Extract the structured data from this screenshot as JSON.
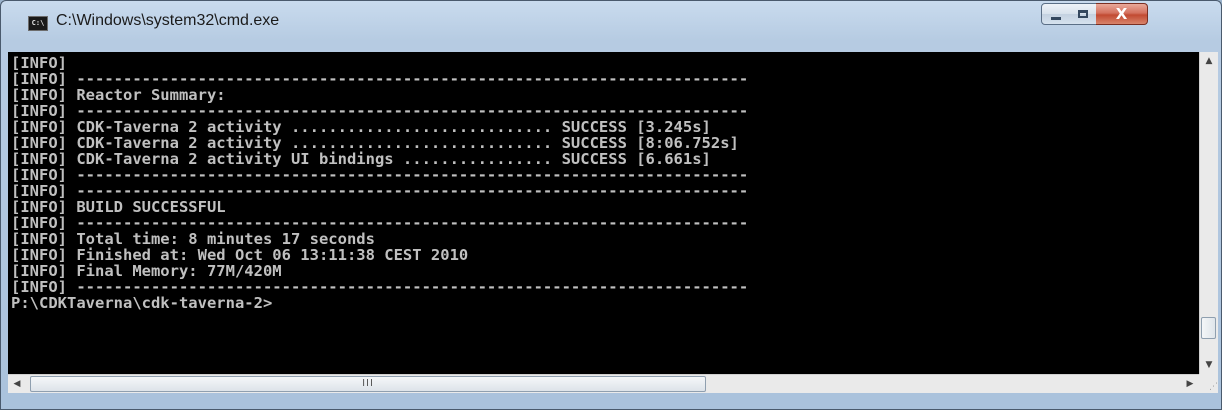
{
  "window": {
    "title": "C:\\Windows\\system32\\cmd.exe",
    "icon": "cmd-icon",
    "icon_label": "C:\\",
    "controls": {
      "minimize": "minimize-icon",
      "maximize": "maximize-icon",
      "close": "close-icon",
      "close_glyph": "X"
    }
  },
  "console": {
    "lines": [
      "[INFO]",
      "[INFO] ------------------------------------------------------------------------",
      "[INFO] Reactor Summary:",
      "[INFO] ------------------------------------------------------------------------",
      "[INFO] CDK-Taverna 2 activity ............................ SUCCESS [3.245s]",
      "[INFO] CDK-Taverna 2 activity ............................ SUCCESS [8:06.752s]",
      "[INFO] CDK-Taverna 2 activity UI bindings ................ SUCCESS [6.661s]",
      "[INFO] ------------------------------------------------------------------------",
      "[INFO] ------------------------------------------------------------------------",
      "[INFO] BUILD SUCCESSFUL",
      "[INFO] ------------------------------------------------------------------------",
      "[INFO] Total time: 8 minutes 17 seconds",
      "[INFO] Finished at: Wed Oct 06 13:11:38 CEST 2010",
      "[INFO] Final Memory: 77M/420M",
      "[INFO] ------------------------------------------------------------------------",
      "P:\\CDKTaverna\\cdk-taverna-2>"
    ],
    "colors": {
      "background": "#000000",
      "foreground": "#c0c0c0"
    }
  },
  "scrollbars": {
    "vertical": {
      "up": "▲",
      "down": "▼"
    },
    "horizontal": {
      "left": "◀",
      "right": "▶",
      "thumb_grip": "III"
    },
    "corner_grip": "⋰"
  }
}
